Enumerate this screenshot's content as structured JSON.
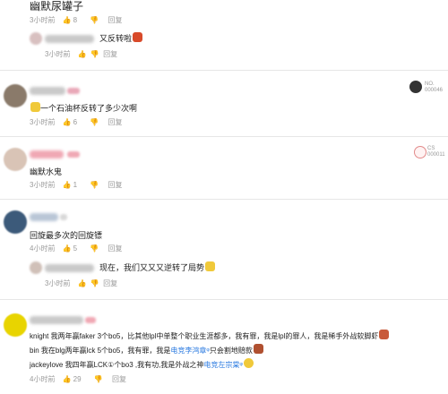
{
  "colors": {
    "link": "#2f7de1",
    "meta": "#999999",
    "text": "#222222"
  },
  "comments": [
    {
      "text": "幽默尿罐子",
      "time": "3小时前",
      "likes": "8",
      "reply": "回复",
      "sub": {
        "text": "又反转啦",
        "time": "3小时前",
        "reply": "回复"
      }
    },
    {
      "text": "一个石油杯反转了多少次啊",
      "time": "3小时前",
      "likes": "6",
      "reply": "回复",
      "medal": {
        "l1": "NO.",
        "l2": "000046"
      }
    },
    {
      "text": "幽默水鬼",
      "time": "3小时前",
      "likes": "1",
      "reply": "回复",
      "medal": {
        "l1": "CS",
        "l2": "000011"
      }
    },
    {
      "text": "回旋最多次的回旋镖",
      "time": "4小时前",
      "likes": "5",
      "reply": "回复",
      "sub": {
        "text": "现在，我们又又又逆转了局势",
        "time": "3小时前",
        "reply": "回复"
      }
    },
    {
      "line1": "knight 我两年赢faker 3个bo5，比其他lpl中单整个职业生涯都多，我有罪，我是lpl的罪人，我是稀手外战软脚虾",
      "line2a": "bin 我在blg两年赢lck 5个bo5，我有罪，我是",
      "line2link": "电竞李鸿章",
      "line2b": "只会割地赔款",
      "line3a": "jackeylove 我四年赢LCK①个bo3 ,我有功,我是外战之神",
      "line3link": "电竞左宗棠",
      "time": "4小时前",
      "likes": "29",
      "reply": "回复"
    }
  ]
}
